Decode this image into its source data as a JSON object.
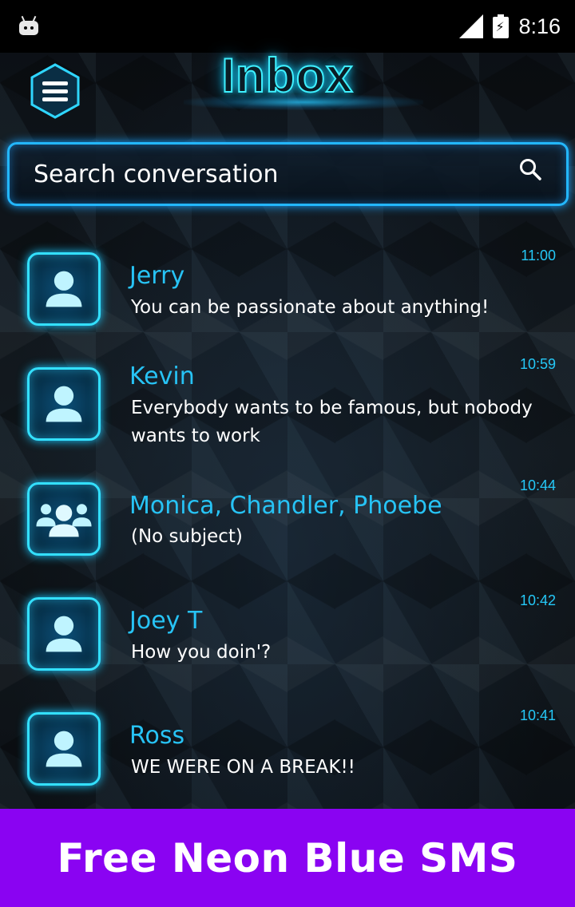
{
  "status_bar": {
    "time": "8:16",
    "icons": [
      "android-icon",
      "signal-icon",
      "battery-charging-icon"
    ]
  },
  "header": {
    "title": "Inbox",
    "menu_icon": "hamburger-menu-icon"
  },
  "search": {
    "placeholder": "Search conversation",
    "icon": "search-icon"
  },
  "conversations": [
    {
      "name": "Jerry",
      "preview": " You can be passionate about anything!",
      "time": "11:00",
      "avatar": "single-contact-icon"
    },
    {
      "name": "Kevin",
      "preview": " Everybody wants to be famous, but nobody wants to work",
      "time": "10:59",
      "avatar": "single-contact-icon"
    },
    {
      "name": "Monica, Chandler, Phoebe",
      "preview": "(No subject)",
      "time": "10:44",
      "avatar": "group-contact-icon"
    },
    {
      "name": "Joey T",
      "preview": "How you doin'?",
      "time": "10:42",
      "avatar": "single-contact-icon"
    },
    {
      "name": "Ross",
      "preview": "WE WERE ON A BREAK!!",
      "time": "10:41",
      "avatar": "single-contact-icon"
    }
  ],
  "banner": {
    "text": "Free Neon Blue SMS",
    "color": "#8a03f2"
  },
  "colors": {
    "accent": "#27c3f5",
    "neon_border": "#23b7ff"
  }
}
